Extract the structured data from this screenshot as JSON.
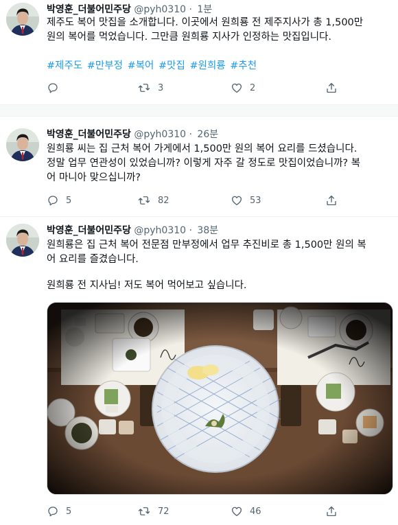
{
  "tweets": [
    {
      "name": "박영훈_더불어민주당",
      "handle": "@pyh0310",
      "dot": "·",
      "time": "1분",
      "lines": [
        "제주도 복어 맛집을 소개합니다. 이곳에서 원희룡 전 제주지사가 총 1,500만",
        "원의 복어를 먹었습니다. 그만큼 원희룡 지사가 인정하는 맛집입니다."
      ],
      "hashtags": [
        "#제주도",
        "#만부정",
        "#복어",
        "#맛집",
        "#원희룡",
        "#추천"
      ],
      "replies": "",
      "retweets": "3",
      "likes": "2"
    },
    {
      "name": "박영훈_더불어민주당",
      "handle": "@pyh0310",
      "dot": "·",
      "time": "26분",
      "lines": [
        "원희룡 씨는 집 근처 복어 가게에서 1,500만 원의 복어 요리를 드셨습니다.",
        "정말 업무 연관성이 있었습니까? 이렇게 자주 갈 정도로 맛집이었습니까? 복",
        "어 마니아 맞으십니까?"
      ],
      "replies": "5",
      "retweets": "82",
      "likes": "53"
    },
    {
      "name": "박영훈_더불어민주당",
      "handle": "@pyh0310",
      "dot": "·",
      "time": "38분",
      "lines": [
        "원희룡은 집 근처 복어 전문점 만부정에서 업무 추진비로 총 1,500만 원의 복",
        "어 요리를 즐겼습니다."
      ],
      "line_after_gap": "원희룡 전 지사님! 저도 복어 먹어보고 싶습니다.",
      "replies": "5",
      "retweets": "72",
      "likes": "46"
    }
  ],
  "icons": {
    "reply": "reply-icon",
    "retweet": "retweet-icon",
    "like": "heart-icon",
    "share": "share-icon"
  },
  "colors": {
    "hashtag": "#1d9bf0",
    "secondary_text": "#536471",
    "text": "#0f1419"
  }
}
